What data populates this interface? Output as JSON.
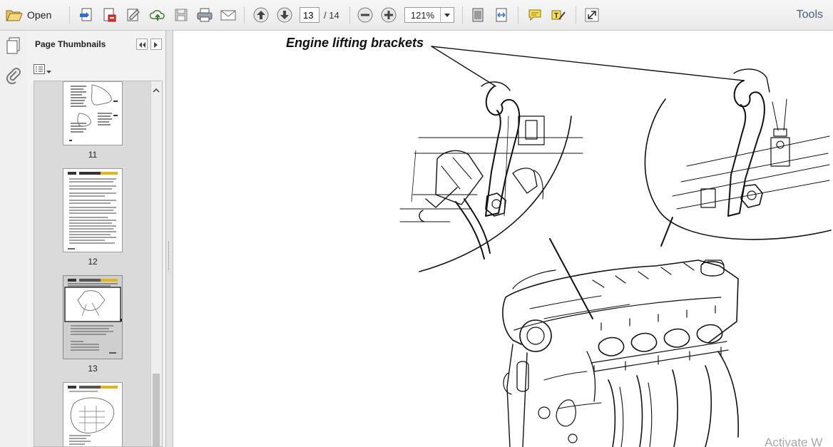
{
  "toolbar": {
    "open_label": "Open",
    "current_page": "13",
    "page_total": "/ 14",
    "zoom": "121%",
    "tools_label": "Tools",
    "icons": [
      "folder-open-icon",
      "create-pdf-icon",
      "edit-pdf-icon",
      "sign-icon",
      "upload-cloud-icon",
      "save-icon",
      "print-icon",
      "email-icon",
      "page-up-icon",
      "page-down-icon",
      "zoom-out-icon",
      "zoom-in-icon",
      "fit-page-icon",
      "fit-width-icon",
      "comment-icon",
      "highlight-text-icon",
      "expand-icon"
    ]
  },
  "sidebar": {
    "title": "Page Thumbnails",
    "thumbnails": [
      {
        "label": "11"
      },
      {
        "label": "12"
      },
      {
        "label": "13",
        "selected": true
      },
      {
        "label": ""
      }
    ]
  },
  "document": {
    "caption": "Engine lifting brackets",
    "watermark": "Activate W"
  },
  "colors": {
    "accent_text": "#4a5d7a",
    "selected_thumb": "#cfcfcf",
    "thumb_header_yellow": "#e3b51c"
  }
}
